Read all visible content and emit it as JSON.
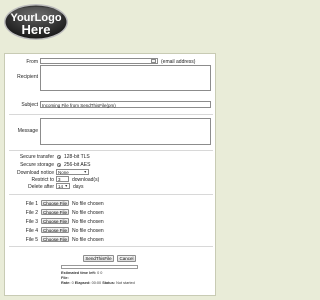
{
  "logo": {
    "line1": "YourLogo",
    "line2": "Here"
  },
  "form": {
    "from_label": "From",
    "from_value": "",
    "from_hint": "(email address)",
    "recipient_label": "Recipient",
    "recipient_value": "",
    "subject_label": "Subject",
    "subject_value": "Incoming File from SendThisFile(pm)",
    "message_label": "Message",
    "message_value": "",
    "secure_transfer_label": "Secure transfer",
    "secure_transfer_value": "128-bit TLS",
    "secure_storage_label": "Secure storage",
    "secure_storage_value": "256-bit AES",
    "download_notice_label": "Download notice",
    "download_notice_value": "None",
    "restrict_label": "Restrict to",
    "restrict_value": "3",
    "restrict_suffix": "download(s)",
    "delete_label": "Delete after",
    "delete_value": "14",
    "delete_suffix": "days"
  },
  "files": [
    {
      "label": "File 1",
      "button": "Choose File",
      "status": "No file chosen"
    },
    {
      "label": "File 2",
      "button": "Choose File",
      "status": "No file chosen"
    },
    {
      "label": "File 3",
      "button": "Choose File",
      "status": "No file chosen"
    },
    {
      "label": "File 4",
      "button": "Choose File",
      "status": "No file chosen"
    },
    {
      "label": "File 5",
      "button": "Choose File",
      "status": "No file chosen"
    }
  ],
  "actions": {
    "send_label": "SendThisFile",
    "cancel_label": "Cancel"
  },
  "progress": {
    "fraction": 0,
    "time_left_label": "Estimated time left:",
    "time_left_value": "0 0",
    "file_label": "File:",
    "file_value": "",
    "rate_label": "Rate:",
    "rate_value": "0",
    "elapsed_label": "Elapsed:",
    "elapsed_value": "00:00",
    "status_label": "Status:",
    "status_value": "Not started"
  },
  "colors": {
    "background": "#e9ecd8",
    "panel": "#ffffff",
    "logo_dark": "#2a2a2a",
    "logo_text": "#ffffff"
  }
}
